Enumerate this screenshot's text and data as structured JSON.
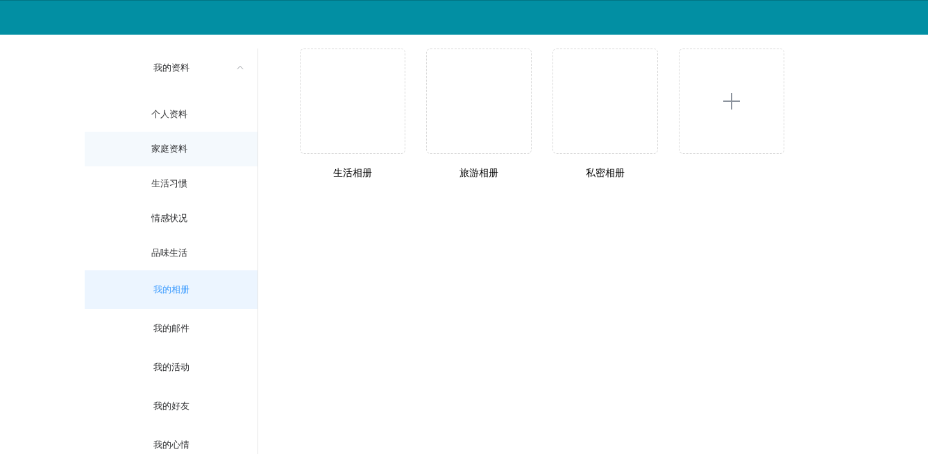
{
  "sidebar": {
    "group": {
      "label": "我的资料",
      "expanded": true,
      "children": [
        {
          "label": "个人资料",
          "highlighted": false
        },
        {
          "label": "家庭资料",
          "highlighted": true
        },
        {
          "label": "生活习惯",
          "highlighted": false
        },
        {
          "label": "情感状况",
          "highlighted": false
        },
        {
          "label": "品味生活",
          "highlighted": false
        }
      ]
    },
    "items": [
      {
        "label": "我的相册",
        "selected": true
      },
      {
        "label": "我的邮件",
        "selected": false
      },
      {
        "label": "我的活动",
        "selected": false
      },
      {
        "label": "我的好友",
        "selected": false
      },
      {
        "label": "我的心情",
        "selected": false
      }
    ]
  },
  "albums": [
    {
      "kind": "album",
      "label": "生活相册"
    },
    {
      "kind": "album",
      "label": "旅游相册"
    },
    {
      "kind": "album",
      "label": "私密相册"
    },
    {
      "kind": "add"
    }
  ]
}
